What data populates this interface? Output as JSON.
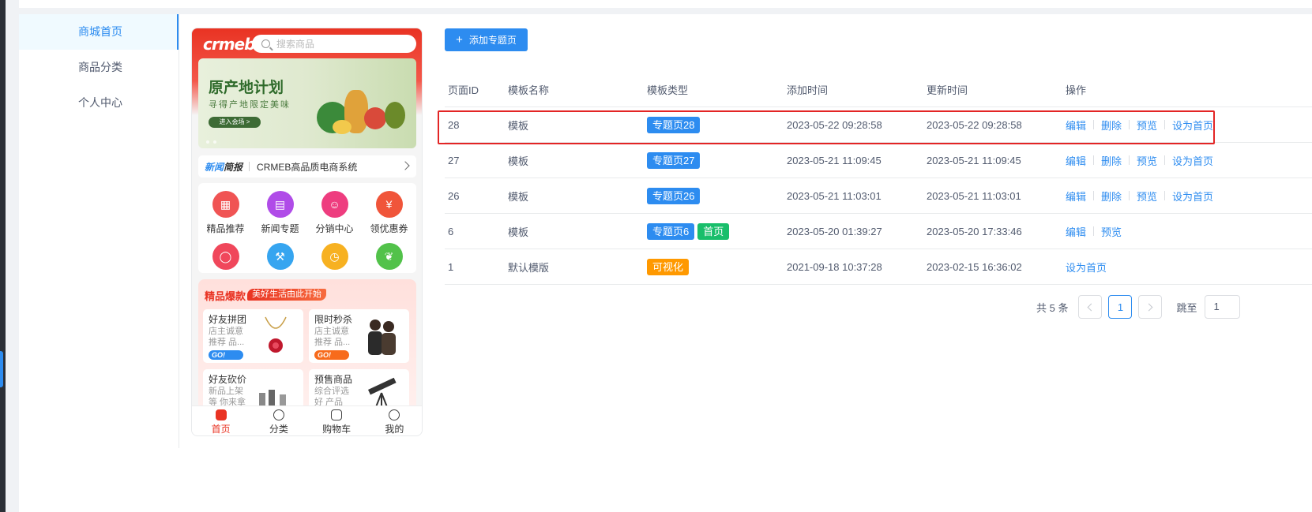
{
  "nav": {
    "items": [
      {
        "label": "商城首页",
        "active": true
      },
      {
        "label": "商品分类",
        "active": false
      },
      {
        "label": "个人中心",
        "active": false
      }
    ]
  },
  "preview": {
    "logo": "crmeb",
    "search_placeholder": "搜索商品",
    "banner": {
      "title": "原产地计划",
      "subtitle": "寻得产地限定美味",
      "button": "进入会场 >"
    },
    "news": {
      "title_a": "新闻",
      "title_b": "简报",
      "text": "CRMEB高品质电商系统"
    },
    "menu": [
      {
        "label": "精品推荐",
        "color": "#f05454"
      },
      {
        "label": "新闻专题",
        "color": "#b04ce8"
      },
      {
        "label": "分销中心",
        "color": "#ee3d7f"
      },
      {
        "label": "领优惠券",
        "color": "#f0553a"
      },
      {
        "label": "",
        "color": "#f0475b"
      },
      {
        "label": "",
        "color": "#36a5f0"
      },
      {
        "label": "",
        "color": "#f7b121"
      },
      {
        "label": "",
        "color": "#52c24a"
      }
    ],
    "hot": {
      "title": "精品爆款",
      "badge": "美好生活由此开始",
      "cards": [
        {
          "title": "好友拼团",
          "desc": "店主诚意推荐 品...",
          "go": "GO!",
          "go_color": "#2d8cf0"
        },
        {
          "title": "限时秒杀",
          "desc": "店主诚意推荐 品...",
          "go": "GO!",
          "go_color": "#f76b1c"
        },
        {
          "title": "好友砍价",
          "desc": "新品上架等 你来拿",
          "go": "",
          "go_color": "#2d8cf0"
        },
        {
          "title": "预售商品",
          "desc": "综合评选好 产品",
          "go": "",
          "go_color": "#f76b1c"
        }
      ]
    },
    "tabs": [
      {
        "label": "首页",
        "active": true
      },
      {
        "label": "分类",
        "active": false
      },
      {
        "label": "购物车",
        "active": false
      },
      {
        "label": "我的",
        "active": false
      }
    ]
  },
  "toolbar": {
    "add_label": "添加专题页"
  },
  "table": {
    "headers": [
      "页面ID",
      "模板名称",
      "模板类型",
      "添加时间",
      "更新时间",
      "操作"
    ],
    "rows": [
      {
        "id": "28",
        "name": "模板",
        "tags": [
          {
            "text": "专题页28",
            "color": "blue"
          }
        ],
        "created": "2023-05-22 09:28:58",
        "updated": "2023-05-22 09:28:58",
        "actions": [
          "编辑",
          "删除",
          "预览",
          "设为首页"
        ]
      },
      {
        "id": "27",
        "name": "模板",
        "tags": [
          {
            "text": "专题页27",
            "color": "blue"
          }
        ],
        "created": "2023-05-21 11:09:45",
        "updated": "2023-05-21 11:09:45",
        "actions": [
          "编辑",
          "删除",
          "预览",
          "设为首页"
        ]
      },
      {
        "id": "26",
        "name": "模板",
        "tags": [
          {
            "text": "专题页26",
            "color": "blue"
          }
        ],
        "created": "2023-05-21 11:03:01",
        "updated": "2023-05-21 11:03:01",
        "actions": [
          "编辑",
          "删除",
          "预览",
          "设为首页"
        ]
      },
      {
        "id": "6",
        "name": "模板",
        "tags": [
          {
            "text": "专题页6",
            "color": "blue"
          },
          {
            "text": "首页",
            "color": "green"
          }
        ],
        "created": "2023-05-20 01:39:27",
        "updated": "2023-05-20 17:33:46",
        "actions": [
          "编辑",
          "预览"
        ]
      },
      {
        "id": "1",
        "name": "默认模版",
        "tags": [
          {
            "text": "可视化",
            "color": "orange"
          }
        ],
        "created": "2021-09-18 10:37:28",
        "updated": "2023-02-15 16:36:02",
        "actions": [
          "设为首页"
        ]
      }
    ]
  },
  "pagination": {
    "total": "共 5 条",
    "current": "1",
    "jump_label": "跳至",
    "jump_value": "1"
  }
}
